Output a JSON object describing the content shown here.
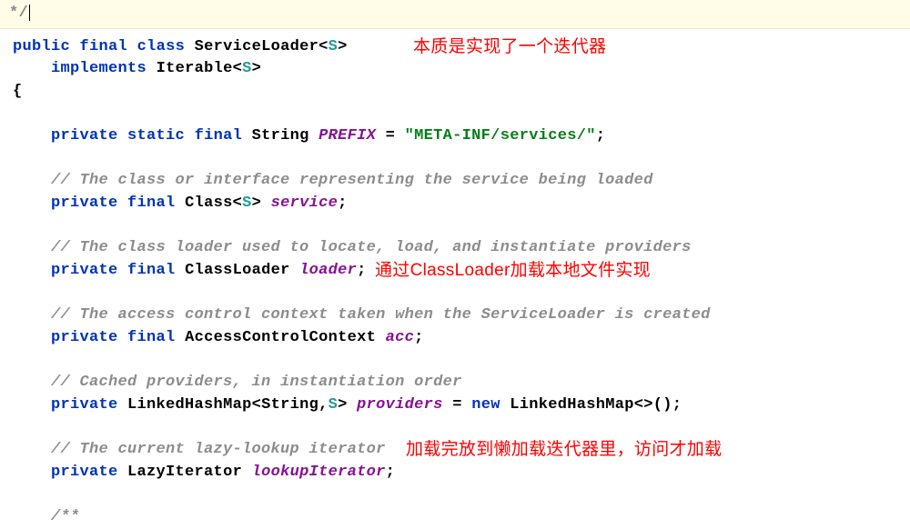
{
  "top": {
    "comment_end": " */"
  },
  "kw": {
    "public": "public",
    "final": "final",
    "class": "class",
    "implements": "implements",
    "private": "private",
    "static": "static",
    "new": "new"
  },
  "types": {
    "ServiceLoader": "ServiceLoader",
    "Iterable": "Iterable",
    "String": "String",
    "Class": "Class",
    "ClassLoader": "ClassLoader",
    "AccessControlContext": "AccessControlContext",
    "LinkedHashMap": "LinkedHashMap",
    "LazyIterator": "LazyIterator"
  },
  "tparam": "S",
  "fields": {
    "PREFIX": "PREFIX",
    "service": "service",
    "loader": "loader",
    "acc": "acc",
    "providers": "providers",
    "lookupIterator": "lookupIterator"
  },
  "strlit": "\"META-INF/services/\"",
  "comments": {
    "c1": "// The class or interface representing the service being loaded",
    "c2": "// The class loader used to locate, load, and instantiate providers",
    "c3": "// The access control context taken when the ServiceLoader is created",
    "c4": "// Cached providers, in instantiation order",
    "c5": "// The current lazy-lookup iterator",
    "c6": "/**"
  },
  "punct": {
    "lt": "<",
    "gt": ">",
    "obrace": "{",
    "cbrace": "}",
    "semi": ";",
    "eq": " = ",
    "paren": "()",
    "diamond": "<>();",
    "comma": ","
  },
  "notes": {
    "n1": "本质是实现了一个迭代器",
    "n2": "通过ClassLoader加载本地文件实现",
    "n3": "加载完放到懒加载迭代器里，访问才加载"
  }
}
